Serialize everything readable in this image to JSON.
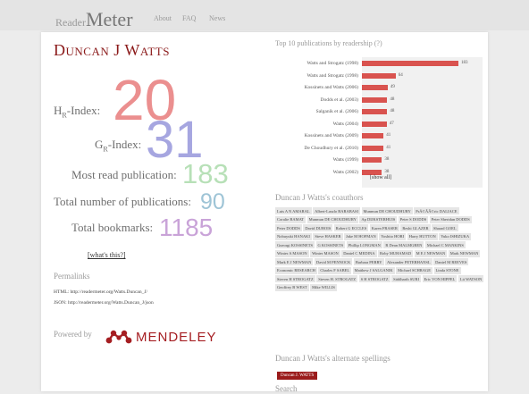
{
  "header": {
    "logo_reader": "Reader",
    "logo_meter": "Meter",
    "nav": [
      "About",
      "FAQ",
      "News"
    ]
  },
  "author": {
    "name": "Duncan J Watts"
  },
  "metrics": {
    "hr_label": "H",
    "hr_sub": "R",
    "hr_suffix": "-Index:",
    "hr_value": "20",
    "gr_label": "G",
    "gr_sub": "R",
    "gr_suffix": "-Index:",
    "gr_value": "31",
    "most_read_label": "Most read publication:",
    "most_read_value": "183",
    "total_pubs_label": "Total number of publications:",
    "total_pubs_value": "90",
    "total_bookmarks_label": "Total bookmarks:",
    "total_bookmarks_value": "1185",
    "whats_this": "[what's this?]"
  },
  "colors": {
    "hr": "#eb8f8f",
    "gr": "#a6a6e0",
    "most_read": "#b7e0b7",
    "total_pubs": "#9ec4d6",
    "total_bookmarks": "#c9a3d8",
    "bar": "#d9534f",
    "accent": "#8b1a1a"
  },
  "permalinks": {
    "heading": "Permalinks",
    "html_link": "HTML: http://readermeter.org/Watts.Duncan_J/",
    "json_link": "JSON: http://readermeter.org/Watts.Duncan_J/json"
  },
  "powered_by": {
    "label": "Powered by",
    "brand": "MENDELEY",
    "icon": "mendeley-logo-icon"
  },
  "chart_title": "Top 10 publications by readership (?)",
  "chart_data": {
    "type": "bar",
    "orientation": "horizontal",
    "title": "Top 10 publications by readership (?)",
    "categories": [
      "Watts and Strogatz (1998)",
      "Watts and Strogatz (1998)",
      "Kossinets and Watts (2006)",
      "Dodds et al. (2003)",
      "Salganik et al. (2006)",
      "Watts (2004)",
      "Kossinets and Watts (2009)",
      "De Choudhury et al. (2010)",
      "Watts (1999)",
      "Watts (2002)"
    ],
    "values": [
      183,
      64,
      49,
      48,
      48,
      47,
      41,
      41,
      38,
      38
    ],
    "xlim": [
      0,
      200
    ],
    "color": "#d9534f"
  },
  "show_all": "[show all]",
  "coauthors": {
    "heading": "Duncan J Watts's coauthors",
    "names": [
      "Luis A N AMARAL",
      "Albert-Laszlo BARABASI",
      "Munmun DE CHOUDHURY",
      "PrÃ©ÂÂ©ric DALIACE",
      "Coralie BAMAT",
      "Munmun DE CHOUDHURY",
      "Ap DIJKSTERHUIS",
      "Peter S DODDS",
      "Peter Sheridan DODDS",
      "Peter DODDS",
      "David DUBOIS",
      "Robert G ECCLES",
      "Karen FRASER",
      "Reshi GLAZER",
      "Sharad GOEL",
      "Nobuyuki HANAKI",
      "Steve HASKER",
      "Jake M HOFMAN",
      "Yoshito HORI",
      "Harry HUTTON",
      "Yuko ISHIZUKA",
      "Gueorgi KOSSINETS",
      "G KOSSINETS",
      "Phillip LONGMAN",
      "R Dean MALMGREN",
      "Michael C MANKINS",
      "Winter A MASON",
      "Winter MASON",
      "Daniel C MEDINA",
      "Roby MUHAMAD",
      "M E J NEWMAN",
      "Mark NEWMAN",
      "Mark E J NEWMAN",
      "David M PENNOCK",
      "Barbara PERRY",
      "Alexander PETERHANSL",
      "Daniel M REEVES",
      "Economic RESEARCH",
      "Charles F SABEL",
      "Matthew J SALGANIK",
      "Michael SCHRAGE",
      "Linda STONE",
      "Steven H STROGATZ",
      "Steven H. STROGATZ",
      "S H STROGATZ",
      "Siddharth SURI",
      "Eric VON HIPPEL",
      "Lii WATSON",
      "Geoffrey B WEST",
      "Mike WILLIS"
    ]
  },
  "alternate_spellings": {
    "heading": "Duncan J Watts's alternate spellings",
    "items": [
      "Duncan J. WATTS"
    ]
  },
  "search": {
    "heading": "Search"
  }
}
